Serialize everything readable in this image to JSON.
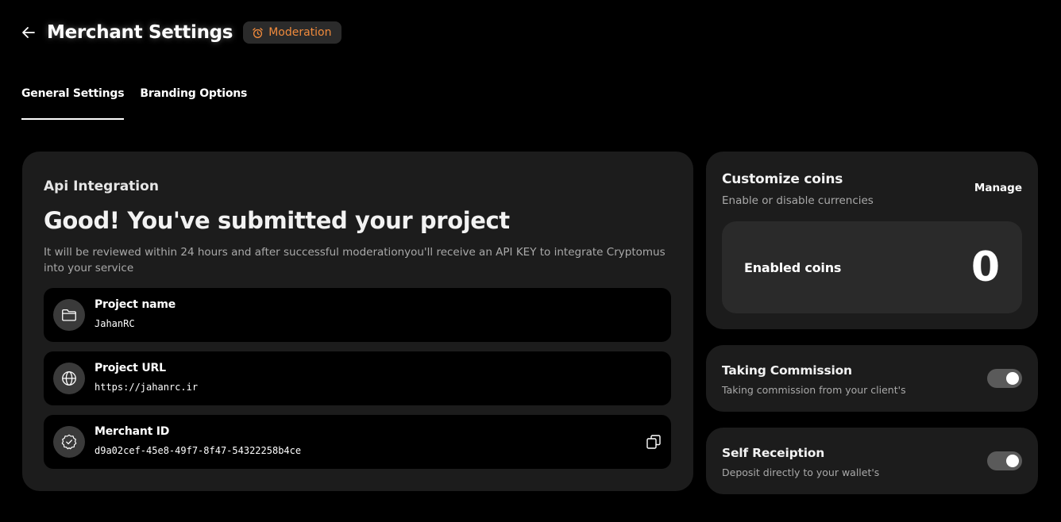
{
  "header": {
    "back_icon": "arrow-left-icon",
    "title": "Merchant Settings",
    "status_badge": {
      "icon": "alarm-clock-icon",
      "label": "Moderation",
      "color": "#f08a3c"
    }
  },
  "tabs": [
    {
      "label": "General Settings",
      "active": true
    },
    {
      "label": "Branding Options",
      "active": false
    }
  ],
  "api": {
    "heading": "Api Integration",
    "title": "Good! You've submitted your project",
    "description": "It will be reviewed within 24 hours and after successful moderationyou'll receive an API KEY to integrate Cryptomus into your service",
    "rows": [
      {
        "icon": "folder-icon",
        "label": "Project name",
        "value": "JahanRC"
      },
      {
        "icon": "globe-icon",
        "label": "Project URL",
        "value": "https://jahanrc.ir"
      },
      {
        "icon": "verified-badge-icon",
        "label": "Merchant ID",
        "value": "d9a02cef-45e8-49f7-8f47-54322258b4ce",
        "action_icon": "copy-icon"
      }
    ]
  },
  "coins": {
    "title": "Customize coins",
    "subtitle": "Enable or disable currencies",
    "manage_label": "Manage",
    "enabled_label": "Enabled coins",
    "enabled_count": "0"
  },
  "commission": {
    "title": "Taking Commission",
    "subtitle": "Taking commission from your client's",
    "enabled": true
  },
  "self_receiption": {
    "title": "Self Receiption",
    "subtitle": "Deposit directly to your wallet's",
    "enabled": true
  }
}
